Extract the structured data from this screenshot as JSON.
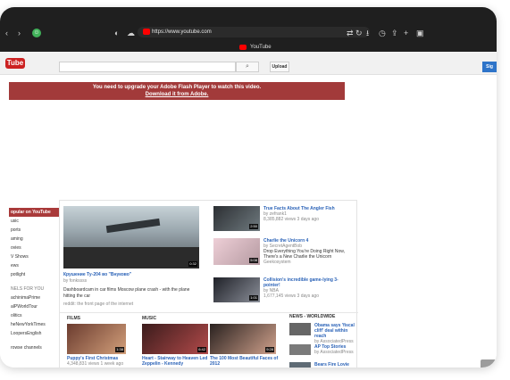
{
  "browser": {
    "url": "https://www.youtube.com",
    "tab_label": "YouTube"
  },
  "youtube": {
    "logo": "Tube",
    "search": {
      "placeholder": "",
      "button_icon": "magnifier-icon"
    },
    "upload_label": "Upload",
    "sign_label": "Sig",
    "flash_notice": {
      "line1": "You need to upgrade your Adobe Flash Player to watch this video.",
      "link": "Download it from Adobe."
    },
    "sidebar": {
      "header": "opular on YouTube",
      "items": [
        "usic",
        "ports",
        "aming",
        "ovies",
        "V Shows",
        "ews",
        "potlight"
      ],
      "channels_title": "NELS FOR YOU",
      "channels": [
        "achinimaPrime",
        "alPWorldTour",
        "olitics",
        "heNewYorkTimes",
        "LoopersEnglish"
      ],
      "browse": "rowse channels"
    },
    "featured": {
      "title": "Крушение Ту-204 во \"Внуково\"",
      "by": "by fonkssss",
      "desc": "Dashboardcam in car films Moscow plane crash - with the plane hitting the car",
      "via": "reddit: the front page of the internet",
      "duration": "0:32"
    },
    "related": [
      {
        "title": "True Facts About The Angler Fish",
        "by": "by zefrank1",
        "meta": "8,385,882 views  3 days ago",
        "duration": "2:50"
      },
      {
        "title": "Charlie the Unicorn 4",
        "by": "by SecretAgentBob",
        "desc": "Drop Everything You're Doing Right Now, There's a New Charlie the Unicorn",
        "via": "Geekosystem",
        "duration": "5:08"
      },
      {
        "title": "Collision's incredible game-lying 3-pointer!",
        "by": "by NBA",
        "meta": "1,677,145 views  3 days ago",
        "duration": "1:01"
      }
    ],
    "sections": {
      "films": {
        "label": "FILMS",
        "title": "Puppy's First Christmas",
        "meta": "4,348,831 views  1 week ago",
        "duration": "1:38"
      },
      "music": {
        "label": "MUSIC",
        "items": [
          {
            "title": "Heart - Stairway to Heaven Led Zeppelin - Kennedy",
            "duration": "6:42"
          },
          {
            "title": "The 100 Most Beautiful Faces of 2012",
            "duration": "9:28"
          }
        ]
      },
      "news": {
        "label": "NEWS - WORLDWIDE",
        "items": [
          {
            "title": "Obama says 'fiscal cliff' deal within reach",
            "by": "by AssociatedPress"
          },
          {
            "title": "AP Top Stories",
            "by": "by AssociatedPress"
          },
          {
            "title": "Bears Fire Lovie",
            "by": ""
          }
        ]
      }
    }
  },
  "colors": {
    "accent": "#a23a3a",
    "link": "#2a62b7"
  }
}
